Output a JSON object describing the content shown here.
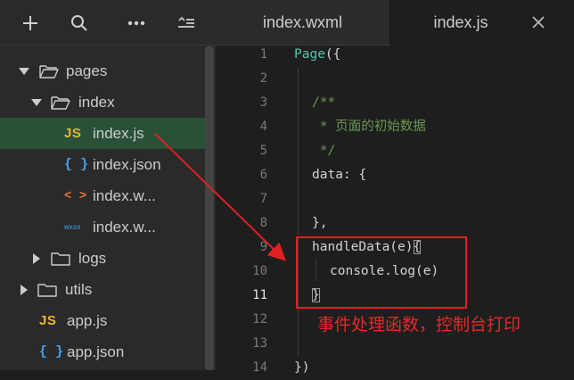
{
  "sidebar": {
    "toolbar": [
      {
        "icon": "plus-icon"
      },
      {
        "icon": "search-icon"
      },
      {
        "icon": "more-icon"
      },
      {
        "icon": "collapse-icon"
      }
    ],
    "tree": [
      {
        "label": "pages",
        "type": "folder",
        "expanded": true
      },
      {
        "label": "index",
        "type": "folder",
        "expanded": true
      },
      {
        "label": "index.js",
        "type": "js",
        "selected": true
      },
      {
        "label": "index.json",
        "type": "json"
      },
      {
        "label": "index.w...",
        "type": "wxml"
      },
      {
        "label": "index.w...",
        "type": "wxss"
      },
      {
        "label": "logs",
        "type": "folder",
        "expanded": false
      },
      {
        "label": "utils",
        "type": "folder",
        "expanded": false
      },
      {
        "label": "app.js",
        "type": "js"
      },
      {
        "label": "app.json",
        "type": "json"
      }
    ],
    "file_badges": {
      "js": "JS",
      "json": "{ }",
      "wxml": "< >",
      "wxss": "wxss"
    }
  },
  "editor": {
    "tabs": [
      {
        "label": "index.wxml",
        "active": false
      },
      {
        "label": "index.js",
        "active": true
      }
    ],
    "line_numbers": [
      "1",
      "2",
      "3",
      "4",
      "5",
      "6",
      "7",
      "8",
      "9",
      "10",
      "11",
      "12",
      "13",
      "14"
    ],
    "active_line": "11",
    "code": {
      "l1_kw": "Page",
      "l1_rest": "({",
      "l3": "/**",
      "l4": " * 页面的初始数据",
      "l5": " */",
      "l6": "data: {",
      "l8": "},",
      "l9_a": "handleData(e)",
      "l9_b": "{",
      "l10": "console.log(e)",
      "l11": "}",
      "l14": "})"
    }
  },
  "annotation": {
    "text": "事件处理函数，控制台打印",
    "color": "#e02020"
  },
  "colors": {
    "selected_row": "#2a5138",
    "keyword": "#4ec9b0",
    "comment": "#6a9955",
    "js_icon": "#e8b838",
    "json_icon": "#46a3f0",
    "wxml_icon": "#e8743b"
  }
}
